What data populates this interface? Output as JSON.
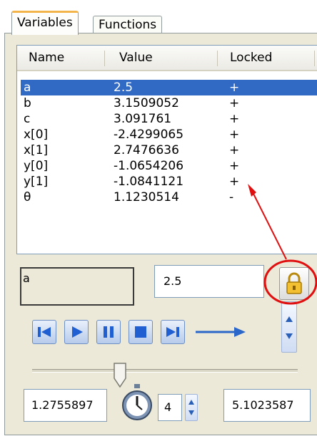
{
  "tabs": [
    {
      "label": "Variables",
      "active": true
    },
    {
      "label": "Functions",
      "active": false
    }
  ],
  "table": {
    "columns": [
      "Name",
      "Value",
      "Locked"
    ],
    "rows": [
      {
        "name": "a",
        "value": "2.5",
        "locked": "+",
        "selected": true
      },
      {
        "name": "b",
        "value": "3.1509052",
        "locked": "+"
      },
      {
        "name": "c",
        "value": "3.091761",
        "locked": "+"
      },
      {
        "name": "x[0]",
        "value": "-2.4299065",
        "locked": "+"
      },
      {
        "name": "x[1]",
        "value": "2.7476636",
        "locked": "+"
      },
      {
        "name": "y[0]",
        "value": "-1.0654206",
        "locked": "+"
      },
      {
        "name": "y[1]",
        "value": "-1.0841121",
        "locked": "+"
      },
      {
        "name": "θ",
        "value": "1.1230514",
        "locked": "-"
      }
    ]
  },
  "editor": {
    "name": "a",
    "value": "2.5",
    "lock_icon": "padlock-icon"
  },
  "playback": {
    "buttons": [
      "skip-to-start-icon",
      "play-icon",
      "pause-icon",
      "stop-icon",
      "skip-to-end-icon"
    ],
    "arrow_icon": "arrow-right-icon"
  },
  "range": {
    "min": "1.2755897",
    "steps": "4",
    "max": "5.1023587",
    "stopwatch_icon": "stopwatch-icon"
  },
  "colors": {
    "selection": "#316ac5",
    "annotation": "#e01010",
    "accent_blue": "#2a67c9",
    "tab_accent": "#f3b54a"
  }
}
